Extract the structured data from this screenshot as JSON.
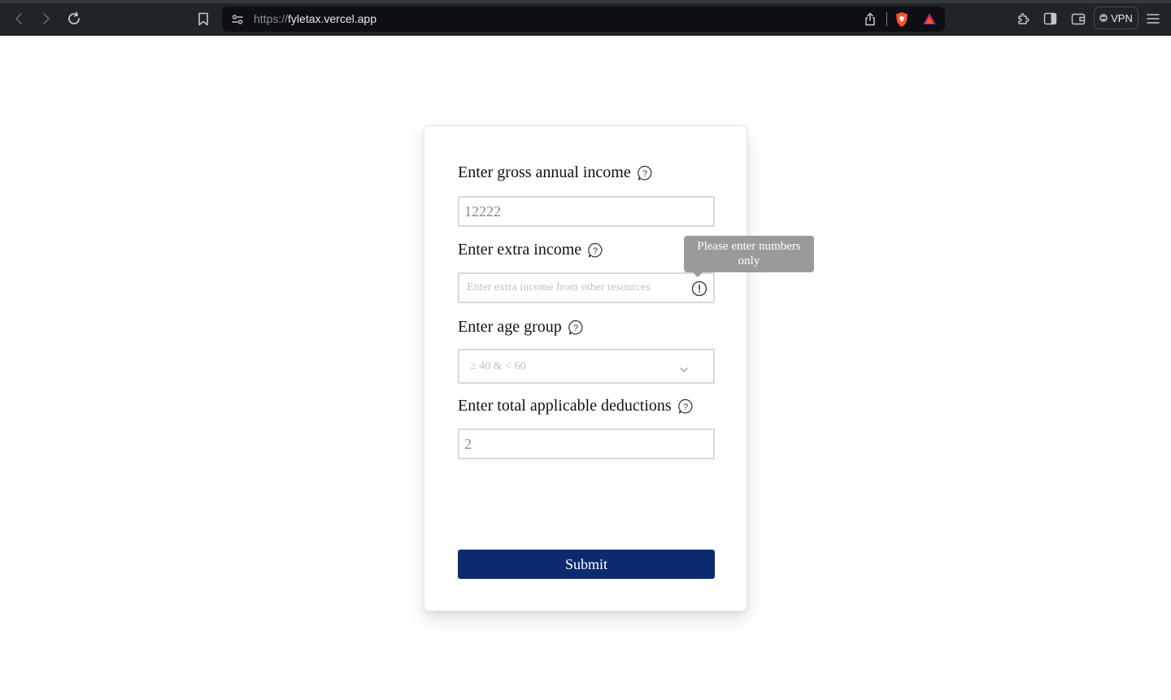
{
  "browser": {
    "url_scheme": "https://",
    "url_host": "fyletax.vercel.app",
    "vpn_label": "VPN"
  },
  "form": {
    "gross_income": {
      "label": "Enter gross annual income",
      "value": "12222"
    },
    "extra_income": {
      "label": "Enter extra income",
      "value": "",
      "placeholder": "Enter extra income from other resources",
      "error_tooltip": "Please enter numbers only"
    },
    "age_group": {
      "label": "Enter age group",
      "selected": "≥ 40 & < 60"
    },
    "deductions": {
      "label": "Enter total applicable deductions",
      "value": "2"
    },
    "submit_label": "Submit"
  },
  "colors": {
    "submit_bg": "#0b2a70",
    "tooltip_bg": "#9a9a9a",
    "chrome_bg": "#202327"
  }
}
